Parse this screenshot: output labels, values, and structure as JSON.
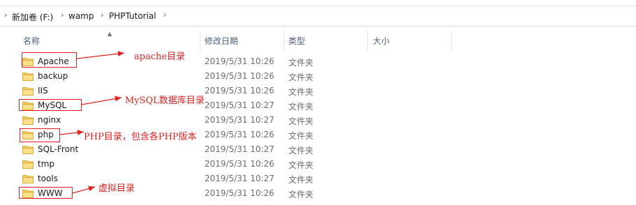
{
  "address": {
    "crumbs": [
      "新加卷 (F:)",
      "wamp",
      "PHPTutorial"
    ]
  },
  "columns": {
    "name": "名称",
    "modified": "修改日期",
    "type": "类型",
    "size": "大小"
  },
  "rows": [
    {
      "name": "Apache",
      "modified": "2019/5/31 10:26",
      "type": "文件夹"
    },
    {
      "name": "backup",
      "modified": "2019/5/31 10:26",
      "type": "文件夹"
    },
    {
      "name": "IIS",
      "modified": "2019/5/31 10:26",
      "type": "文件夹"
    },
    {
      "name": "MySQL",
      "modified": "2019/5/31 10:27",
      "type": "文件夹"
    },
    {
      "name": "nginx",
      "modified": "2019/5/31 10:27",
      "type": "文件夹"
    },
    {
      "name": "php",
      "modified": "2019/5/31 10:26",
      "type": "文件夹"
    },
    {
      "name": "SQL-Front",
      "modified": "2019/5/31 10:27",
      "type": "文件夹"
    },
    {
      "name": "tmp",
      "modified": "2019/5/31 10:26",
      "type": "文件夹"
    },
    {
      "name": "tools",
      "modified": "2019/5/31 10:27",
      "type": "文件夹"
    },
    {
      "name": "WWW",
      "modified": "2019/5/31 10:26",
      "type": "文件夹"
    }
  ],
  "annotations": {
    "apache": "apache目录",
    "mysql": "MySQL数据库目录",
    "php": "PHP目录，包含各PHP版本",
    "www": "虚拟目录"
  },
  "icons": {
    "folder": "folder-icon",
    "breadcrumb_separator": "chevron-right-icon",
    "sort": "sort-ascending-icon"
  },
  "colors": {
    "annotation": "#e02020",
    "header_text": "#4c607a",
    "folder_fill": "#f6d16b"
  }
}
